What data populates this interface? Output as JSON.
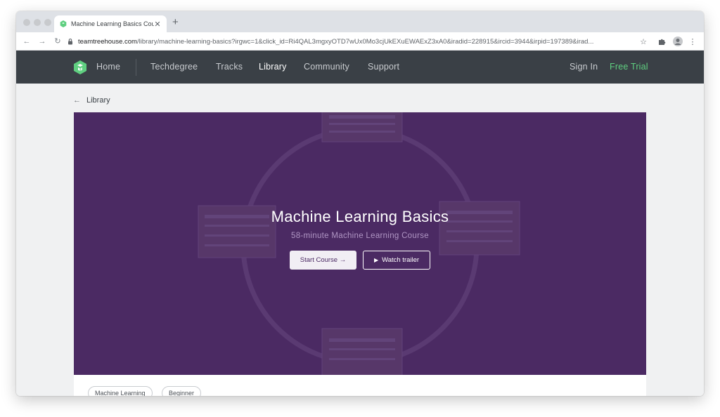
{
  "browser": {
    "tab_title": "Machine Learning Basics Cours",
    "tab_close": "✕",
    "new_tab": "+",
    "url_host": "teamtreehouse.com",
    "url_path": "/library/machine-learning-basics?irgwc=1&click_id=Ri4QAL3mgxyOTD7wUx0Mo3cjUkEXuEWAExZ3xA0&iradid=228915&ircid=3944&irpid=197389&irad..."
  },
  "nav": {
    "home": "Home",
    "links": [
      "Techdegree",
      "Tracks",
      "Library",
      "Community",
      "Support"
    ],
    "active": "Library",
    "sign_in": "Sign In",
    "free_trial": "Free Trial"
  },
  "page": {
    "back_label": "Library"
  },
  "hero": {
    "title": "Machine Learning Basics",
    "subtitle": "58-minute Machine Learning Course",
    "start_button": "Start Course →",
    "trailer_button": "Watch trailer"
  },
  "tags": [
    "Machine Learning",
    "Beginner"
  ],
  "colors": {
    "nav_bg": "#3a4046",
    "hero_bg": "#4b2a63",
    "accent_green": "#5fcf80"
  }
}
